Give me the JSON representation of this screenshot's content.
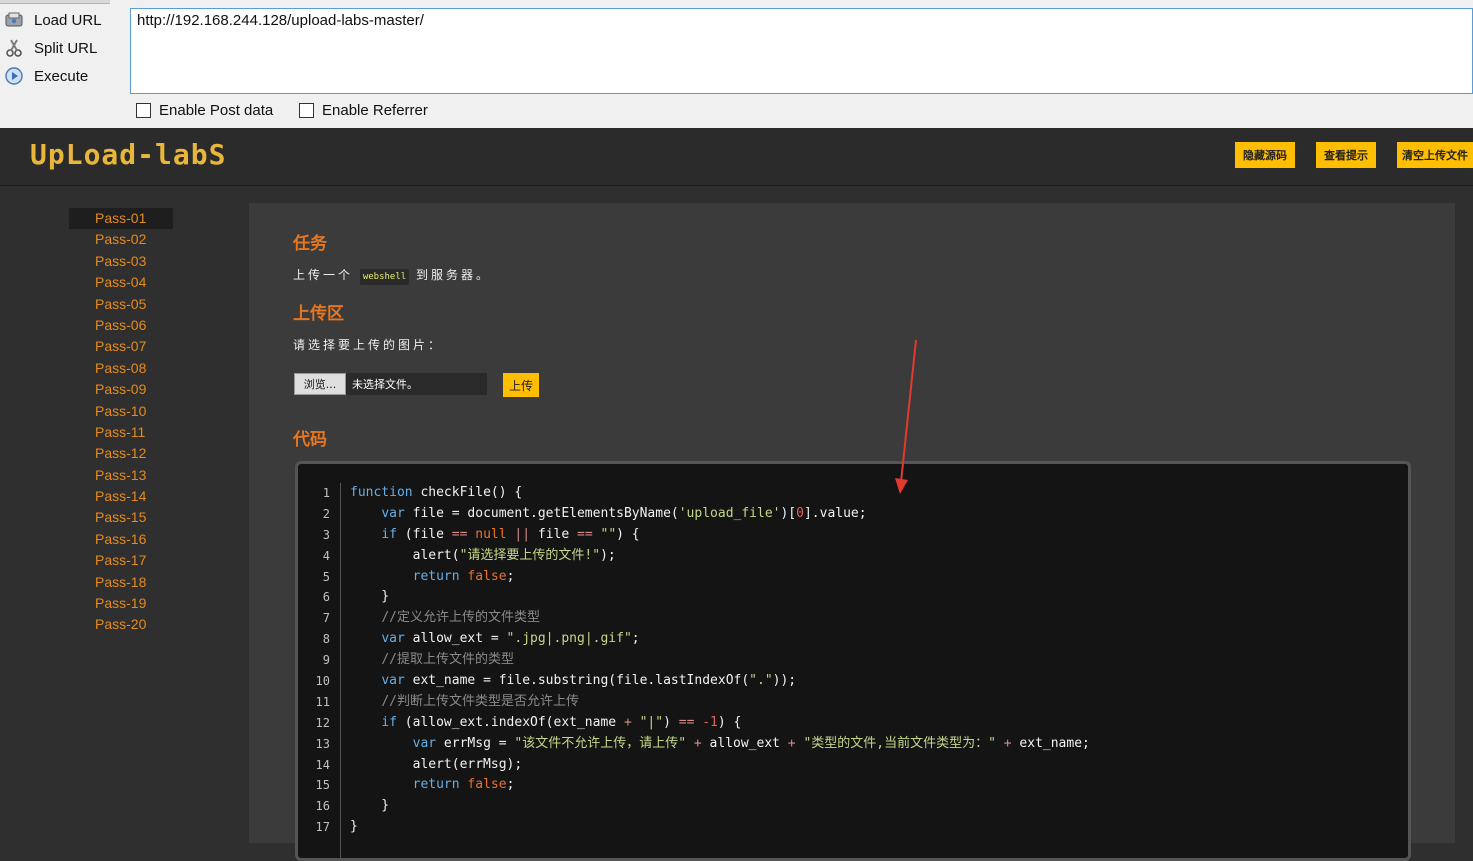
{
  "hackbar": {
    "load_url": "Load URL",
    "split_url": "Split URL",
    "execute": "Execute",
    "url_value": "http://192.168.244.128/upload-labs-master/",
    "enable_post": "Enable Post data",
    "enable_referrer": "Enable Referrer"
  },
  "header": {
    "logo": "UpLoad-labS",
    "btn_hide_source": "隐藏源码",
    "btn_show_hint": "查看提示",
    "btn_clear_files": "清空上传文件"
  },
  "sidebar": {
    "items": [
      "Pass-01",
      "Pass-02",
      "Pass-03",
      "Pass-04",
      "Pass-05",
      "Pass-06",
      "Pass-07",
      "Pass-08",
      "Pass-09",
      "Pass-10",
      "Pass-11",
      "Pass-12",
      "Pass-13",
      "Pass-14",
      "Pass-15",
      "Pass-16",
      "Pass-17",
      "Pass-18",
      "Pass-19",
      "Pass-20"
    ],
    "active": "Pass-01"
  },
  "main": {
    "task_title": "任务",
    "task_prefix": "上传一个",
    "task_code": "webshell",
    "task_suffix": "到服务器。",
    "upload_title": "上传区",
    "choose_label": "请选择要上传的图片：",
    "browse_label": "浏览...",
    "file_status": "未选择文件。",
    "upload_button": "上传",
    "code_title": "代码"
  },
  "code": {
    "line_numbers": [
      "1",
      "2",
      "3",
      "4",
      "5",
      "6",
      "7",
      "8",
      "9",
      "10",
      "11",
      "12",
      "13",
      "14",
      "15",
      "16",
      "17"
    ],
    "lines": [
      "function checkFile() {",
      "    var file = document.getElementsByName('upload_file')[0].value;",
      "    if (file == null || file == \"\") {",
      "        alert(\"请选择要上传的文件!\");",
      "        return false;",
      "    }",
      "    //定义允许上传的文件类型",
      "    var allow_ext = \".jpg|.png|.gif\";",
      "    //提取上传文件的类型",
      "    var ext_name = file.substring(file.lastIndexOf(\".\"));",
      "    //判断上传文件类型是否允许上传",
      "    if (allow_ext.indexOf(ext_name + \"|\") == -1) {",
      "        var errMsg = \"该文件不允许上传，请上传\" + allow_ext + \"类型的文件,当前文件类型为：\" + ext_name;",
      "        alert(errMsg);",
      "        return false;",
      "    }",
      "}"
    ]
  },
  "colors": {
    "accent_orange": "#e6761f",
    "button_yellow": "#ffbf00",
    "annotation_arrow": "#e23a2e"
  }
}
